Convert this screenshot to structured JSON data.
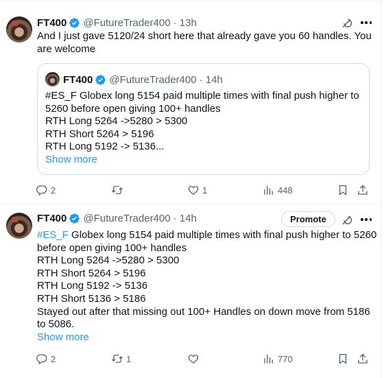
{
  "tweets": [
    {
      "author_name": "FT400",
      "author_handle": "@FutureTrader400",
      "time": "· 13h",
      "text_lines": [
        "And I just gave 5120/24 short here that already gave you 60 handles.  You",
        "are welcome"
      ],
      "quote": {
        "author_name": "FT400",
        "author_handle": "@FutureTrader400",
        "time": "· 14h",
        "hashtag": "#ES_F",
        "first_line_rest": " Globex long 5154 paid multiple times with final push higher to",
        "lines": [
          "5260 before open giving 100+ handles",
          "RTH Long 5264 ->5280 > 5300",
          "RTH Short 5264 > 5196",
          "RTH Long 5192 -> 5136..."
        ],
        "show_more": "Show more"
      },
      "stats": {
        "replies": "2",
        "reposts": "",
        "likes": "1",
        "views": "448"
      }
    },
    {
      "author_name": "FT400",
      "author_handle": "@FutureTrader400",
      "time": "· 14h",
      "promote_label": "Promote",
      "hashtag": "#ES_F",
      "first_line_rest": " Globex long 5154 paid multiple times with final push higher to 5260",
      "lines": [
        "before open giving 100+ handles",
        "RTH Long 5264 ->5280 > 5300",
        "RTH Short 5264 > 5196",
        "RTH Long 5192 -> 5136",
        "RTH Short 5136 > 5186",
        "Stayed out after that missing out 100+ Handles on down move from 5186",
        "to 5086."
      ],
      "show_more": "Show more",
      "stats": {
        "replies": "2",
        "reposts": "1",
        "likes": "",
        "views": "770"
      }
    }
  ],
  "icons": {
    "verified": "verified-badge-icon",
    "grok": "grok-icon",
    "more": "more-icon",
    "reply": "reply-icon",
    "repost": "repost-icon",
    "like": "like-icon",
    "views": "views-icon",
    "bookmark": "bookmark-icon",
    "share": "share-icon"
  },
  "colors": {
    "accent": "#1d9bf0",
    "secondary_text": "#536471",
    "border": "#cfd9de"
  }
}
